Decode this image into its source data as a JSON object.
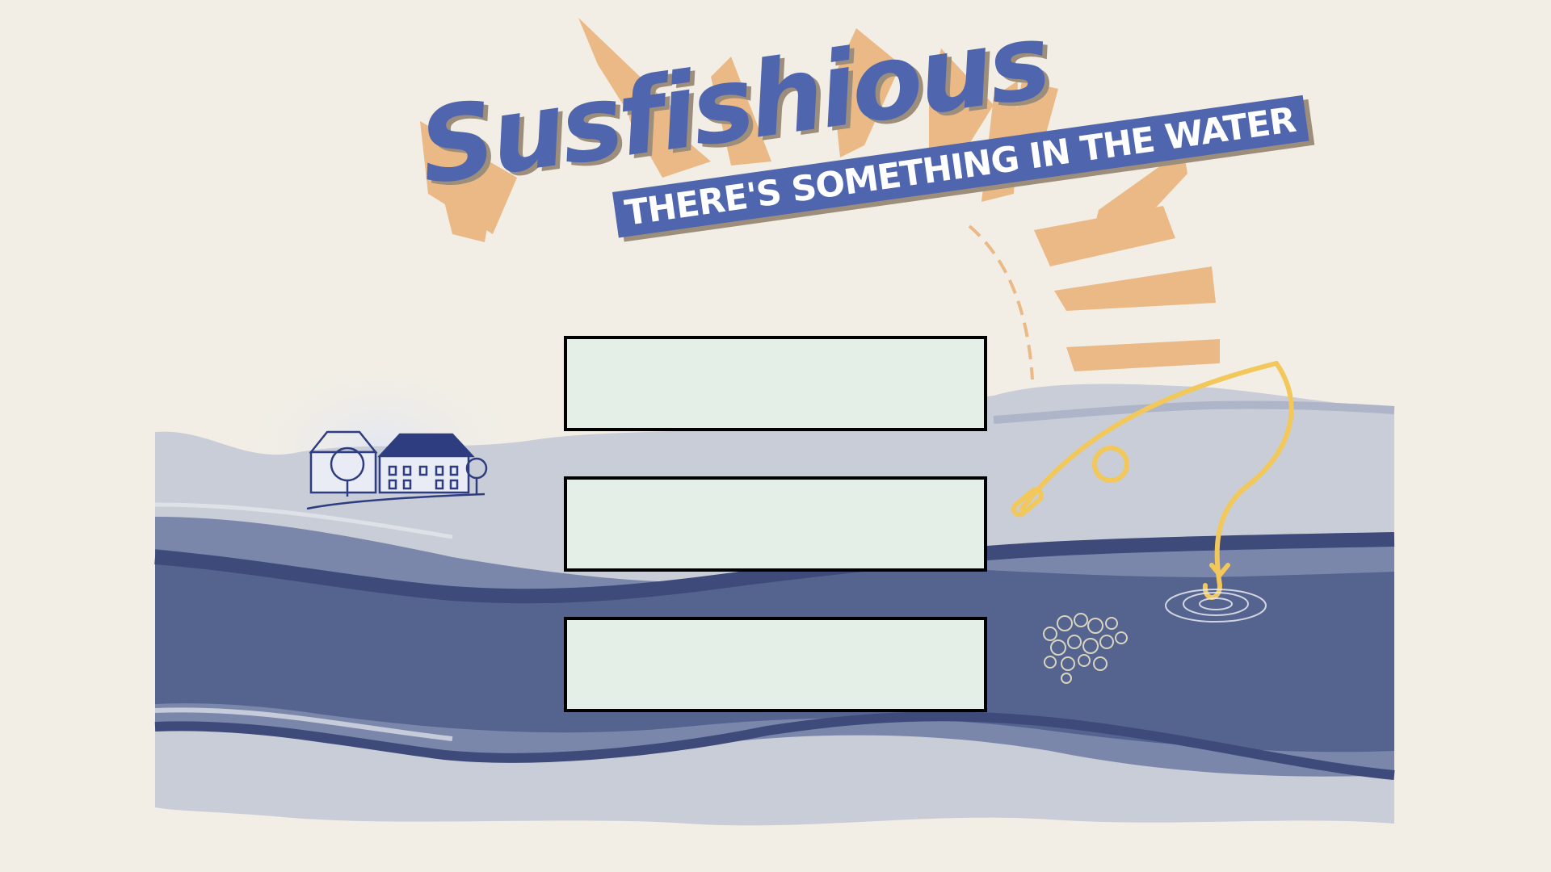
{
  "title": {
    "main": "Susfishious",
    "tagline": "THERE'S SOMETHING IN THE WATER"
  },
  "menu": {
    "buttons": [
      {
        "label": ""
      },
      {
        "label": ""
      },
      {
        "label": ""
      }
    ]
  },
  "icons": {
    "sun": "sun-rays-icon",
    "village": "village-houses-icon",
    "fishing_rod": "fishing-rod-icon",
    "bubbles": "bubbles-icon",
    "ripples": "water-ripple-icon"
  },
  "colors": {
    "background": "#f2eee5",
    "title_blue": "#4f65ad",
    "sun_orange": "#ebb985",
    "river_dark": "#4a5888",
    "river_light": "#c9cdd8",
    "rod_yellow": "#f2c85a",
    "box_fill": "#e4efe8",
    "box_border": "#000000"
  }
}
